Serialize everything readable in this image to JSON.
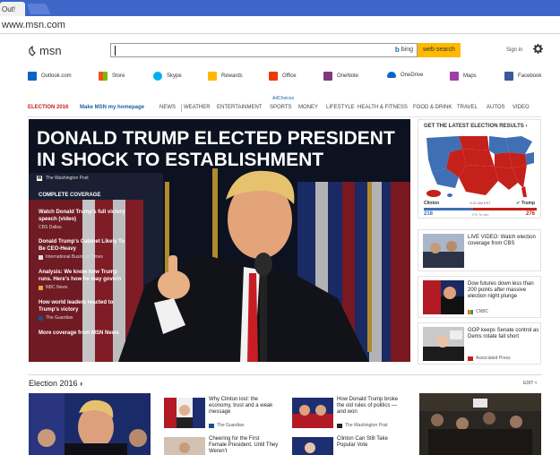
{
  "browser": {
    "tab_title": "Out!",
    "url": "www.msn.com"
  },
  "header": {
    "logo_text": "msn",
    "search_placeholder": "",
    "bing_label": "bing",
    "web_search_label": "web search",
    "signin_label": "Sign in"
  },
  "apps": [
    {
      "label": "Outlook.com",
      "icon": "outlook-icon",
      "color": "#0a64c8"
    },
    {
      "label": "Store",
      "icon": "store-icon",
      "color": "#f25022"
    },
    {
      "label": "Skype",
      "icon": "skype-icon",
      "color": "#00aff0"
    },
    {
      "label": "Rewards",
      "icon": "rewards-icon",
      "color": "#ffb900"
    },
    {
      "label": "Office",
      "icon": "office-icon",
      "color": "#eb3c00"
    },
    {
      "label": "OneNote",
      "icon": "onenote-icon",
      "color": "#80397b"
    },
    {
      "label": "OneDrive",
      "icon": "onedrive-icon",
      "color": "#0a64c8"
    },
    {
      "label": "Maps",
      "icon": "maps-icon",
      "color": "#a03fa8"
    },
    {
      "label": "Facebook",
      "icon": "facebook-icon",
      "color": "#3b5998"
    }
  ],
  "adchoices": "AdChoices",
  "nav": {
    "election": "ELECTION 2016",
    "homepage": "Make MSN my homepage",
    "items": [
      "NEWS",
      "WEATHER",
      "ENTERTAINMENT",
      "SPORTS",
      "MONEY",
      "LIFESTYLE",
      "HEALTH & FITNESS",
      "FOOD & DRINK",
      "TRAVEL",
      "AUTOS",
      "VIDEO"
    ]
  },
  "hero": {
    "title": "DONALD TRUMP ELECTED PRESIDENT IN SHOCK TO ESTABLISHMENT",
    "source": "The Washington Post",
    "coverage_heading": "COMPLETE COVERAGE",
    "coverage": [
      {
        "title": "Watch Donald Trump's full victory speech (video)",
        "source": "CBS Dallas"
      },
      {
        "title": "Donald Trump's Cabinet Likely To Be CEO-Heavy",
        "source": "International Business Times"
      },
      {
        "title": "Analysis: We know how Trump runs. Here's how he may govern",
        "source": "NBC News"
      },
      {
        "title": "How world leaders reacted to Trump's victory",
        "source": "The Guardian"
      }
    ],
    "more": "More coverage from MSN News"
  },
  "election_map": {
    "heading": "GET THE LATEST ELECTION RESULTS",
    "clinton_label": "Clinton",
    "trump_label": "Trump",
    "clinton_votes": "218",
    "trump_votes": "276",
    "time": "9:31 AM EST",
    "to_win": "270 To win",
    "clinton_share": 0.44,
    "colors": {
      "dem": "#3f6fb5",
      "rep": "#c4211a"
    }
  },
  "side_stories": [
    {
      "title": "LIVE VIDEO: Watch election coverage from CBS",
      "source": ""
    },
    {
      "title": "Dow futures down less than 200 points after massive election night plunge",
      "source": "CNBC"
    },
    {
      "title": "GOP keeps Senate control as Dems rotate fall short",
      "source": "Associated Press"
    }
  ],
  "section": {
    "title": "Election 2016",
    "edit_label": "EDIT",
    "cards": [
      {
        "title": "Why Clinton lost: the economy, trust and a weak message",
        "source": "The Guardian"
      },
      {
        "title": "How Donald Trump broke the old rules of politics — and won",
        "source": "The Washington Post"
      }
    ],
    "cards2": [
      {
        "title": "Cheering for the First Female President, Until They Weren't"
      },
      {
        "title": "Clinton Can Still Take Popular Vote"
      }
    ]
  }
}
